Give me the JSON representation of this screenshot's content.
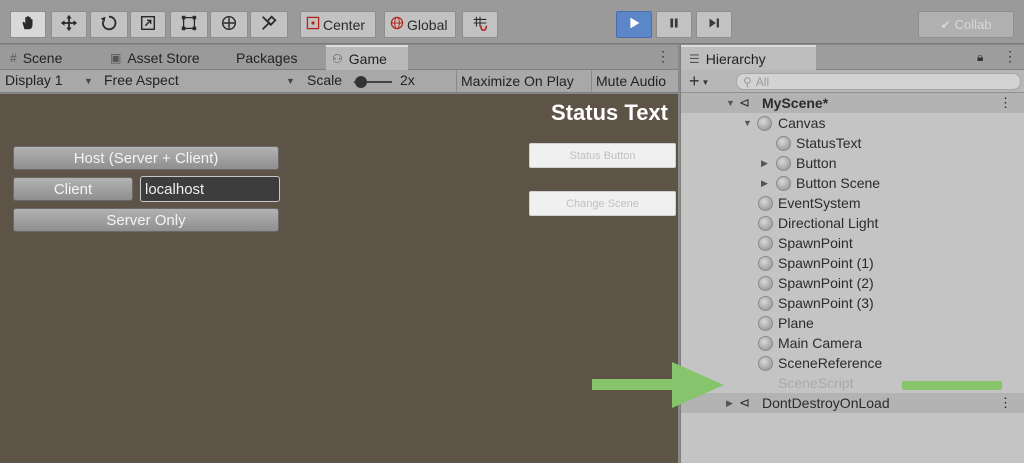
{
  "toolbar": {
    "pivot_label": "Center",
    "space_label": "Global",
    "collab_label": "Collab",
    "tool_icons": [
      "hand-icon",
      "move-icon",
      "rotate-icon",
      "scale-icon",
      "rect-icon",
      "transform-icon",
      "custom-tool-icon"
    ],
    "accent_color": "#5b87c9"
  },
  "left_tabs": [
    {
      "label": "Scene",
      "icon": "scene-icon"
    },
    {
      "label": "Asset Store",
      "icon": "store-icon"
    },
    {
      "label": "Packages",
      "icon": ""
    },
    {
      "label": "Game",
      "icon": "game-icon"
    }
  ],
  "game_bar": {
    "display": "Display 1",
    "aspect": "Free Aspect",
    "scale_label": "Scale",
    "scale_value": "2x",
    "maximize_label": "Maximize On Play",
    "mute_label": "Mute Audio"
  },
  "game_view": {
    "host_button": "Host (Server + Client)",
    "client_button": "Client",
    "address_value": "localhost",
    "server_button": "Server Only",
    "status_text": "Status Text",
    "status_button": "Status Button",
    "change_scene_button": "Change Scene"
  },
  "hierarchy": {
    "tab_label": "Hierarchy",
    "search_placeholder": "All",
    "items": [
      {
        "label": "MyScene*"
      },
      {
        "label": "Canvas"
      },
      {
        "label": "StatusText"
      },
      {
        "label": "Button"
      },
      {
        "label": "Button Scene"
      },
      {
        "label": "EventSystem"
      },
      {
        "label": "Directional Light"
      },
      {
        "label": "SpawnPoint"
      },
      {
        "label": "SpawnPoint (1)"
      },
      {
        "label": "SpawnPoint (2)"
      },
      {
        "label": "SpawnPoint (3)"
      },
      {
        "label": "Plane"
      },
      {
        "label": "Main Camera"
      },
      {
        "label": "SceneReference"
      },
      {
        "label": "SceneScript"
      },
      {
        "label": "DontDestroyOnLoad"
      }
    ]
  },
  "highlight_color": "#86c56c"
}
